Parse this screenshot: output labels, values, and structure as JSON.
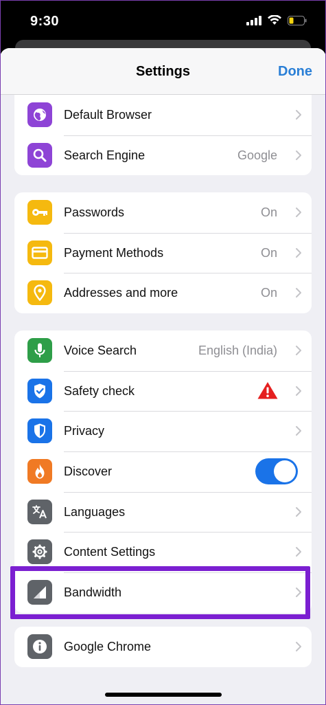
{
  "status_bar": {
    "time": "9:30",
    "icons": [
      "signal-icon",
      "wifi-icon",
      "battery-low-icon"
    ]
  },
  "nav": {
    "title": "Settings",
    "done_label": "Done"
  },
  "groups": [
    {
      "items": [
        {
          "label": "Default Browser",
          "value": "",
          "icon": "globe-icon",
          "color": "#8e44d6"
        },
        {
          "label": "Search Engine",
          "value": "Google",
          "icon": "search-icon",
          "color": "#8e44d6"
        }
      ]
    },
    {
      "items": [
        {
          "label": "Passwords",
          "value": "On",
          "icon": "key-icon",
          "color": "#f5b90f"
        },
        {
          "label": "Payment Methods",
          "value": "On",
          "icon": "credit-card-icon",
          "color": "#f5b90f"
        },
        {
          "label": "Addresses and more",
          "value": "On",
          "icon": "location-pin-icon",
          "color": "#f5b90f"
        }
      ]
    },
    {
      "items": [
        {
          "label": "Voice Search",
          "value": "English (India)",
          "icon": "microphone-icon",
          "color": "#2e9e48"
        },
        {
          "label": "Safety check",
          "value": "",
          "icon": "shield-check-icon",
          "color": "#1a73e8",
          "status": "warning-icon"
        },
        {
          "label": "Privacy",
          "value": "",
          "icon": "shield-icon",
          "color": "#1a73e8"
        },
        {
          "label": "Discover",
          "value": "",
          "icon": "flame-icon",
          "color": "#f07a24",
          "toggle_on": true
        },
        {
          "label": "Languages",
          "value": "",
          "icon": "translate-icon",
          "color": "#5f6368"
        },
        {
          "label": "Content Settings",
          "value": "",
          "icon": "gear-icon",
          "color": "#5f6368"
        },
        {
          "label": "Bandwidth",
          "value": "",
          "icon": "bandwidth-icon",
          "color": "#5f6368"
        }
      ]
    },
    {
      "items": [
        {
          "label": "Google Chrome",
          "value": "",
          "icon": "info-icon",
          "color": "#5f6368"
        }
      ]
    }
  ],
  "highlight_color": "#7b1fd1"
}
